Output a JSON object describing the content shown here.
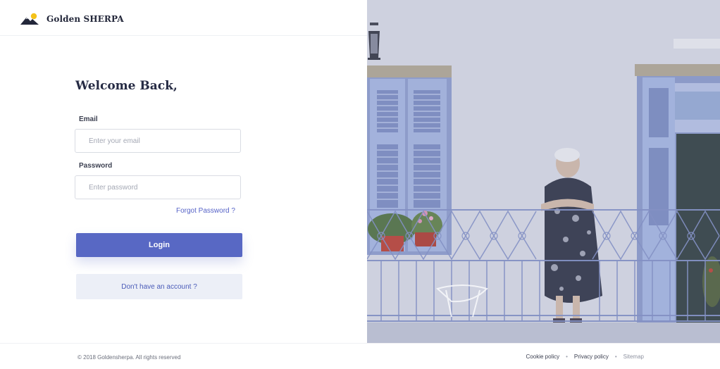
{
  "brand": {
    "name": "Golden SHERPA",
    "logo_icon": "mountain-sun-icon"
  },
  "login": {
    "title": "Welcome Back,",
    "email_label": "Email",
    "email_placeholder": "Enter your email",
    "email_value": "",
    "password_label": "Password",
    "password_placeholder": "Enter password",
    "password_value": "",
    "forgot_label": "Forgot Password ?",
    "login_button": "Login",
    "signup_button": "Don't have an account ?"
  },
  "footer": {
    "copyright": "© 2018 Goldensherpa. All rights reserved",
    "links": {
      "cookie": "Cookie policy",
      "privacy": "Privacy policy",
      "sitemap": "Sitemap"
    }
  },
  "colors": {
    "accent": "#5868c4",
    "secondary_button_bg": "#eceff7",
    "link": "#5663c7",
    "photo_tint": "#c7cbdc"
  }
}
